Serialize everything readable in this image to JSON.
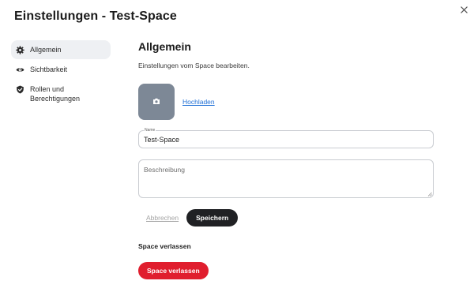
{
  "dialog": {
    "title": "Einstellungen - Test-Space",
    "close_icon": "close-icon"
  },
  "sidebar": {
    "items": [
      {
        "label": "Allgemein",
        "icon": "gear-icon",
        "active": true
      },
      {
        "label": "Sichtbarkeit",
        "icon": "eye-icon",
        "active": false
      },
      {
        "label": "Rollen und Berechtigungen",
        "icon": "shield-check-icon",
        "active": false
      }
    ]
  },
  "main": {
    "title": "Allgemein",
    "description": "Einstellungen vom Space bearbeiten.",
    "avatar": {
      "icon": "camera-icon",
      "upload_label": "Hochladen"
    },
    "name_field": {
      "label": "Name",
      "value": "Test-Space"
    },
    "description_field": {
      "placeholder": "Beschreibung",
      "value": ""
    },
    "buttons": {
      "cancel_label": "Abbrechen",
      "save_label": "Speichern"
    },
    "leave": {
      "heading": "Space verlassen",
      "button_label": "Space verlassen"
    }
  },
  "colors": {
    "accent_dark": "#202124",
    "danger": "#e01e2e",
    "link": "#1f6fd6",
    "avatar_bg": "#7d8896",
    "active_nav_bg": "#eef0f3"
  }
}
